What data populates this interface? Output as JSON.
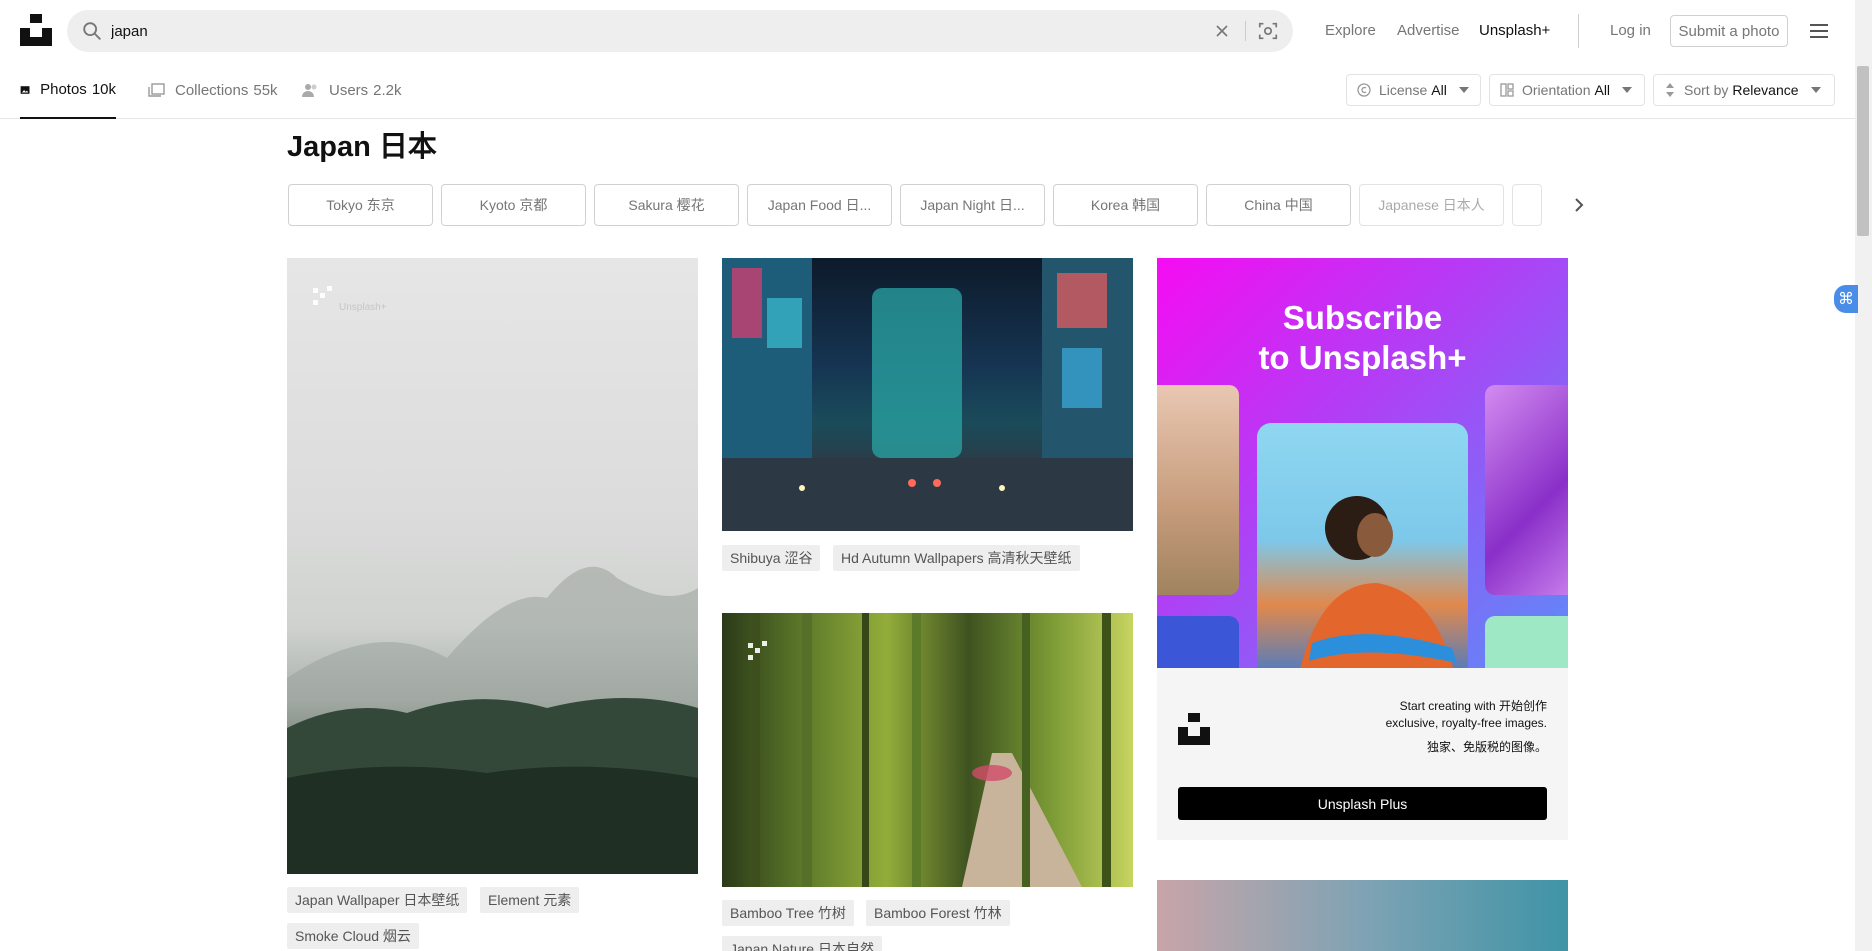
{
  "header": {
    "search_value": "japan",
    "nav": {
      "explore": "Explore",
      "advertise": "Advertise",
      "plus": "Unsplash+"
    },
    "login": "Log in",
    "submit": "Submit a photo"
  },
  "tabs": [
    {
      "label": "Photos",
      "count": "10k"
    },
    {
      "label": "Collections",
      "count": "55k"
    },
    {
      "label": "Users",
      "count": "2.2k"
    }
  ],
  "filters": {
    "license": {
      "label": "License",
      "value": "All"
    },
    "orientation": {
      "label": "Orientation",
      "value": "All"
    },
    "sort": {
      "label": "Sort by",
      "value": "Relevance"
    }
  },
  "page_title": "Japan 日本",
  "related": [
    "Tokyo 东京",
    "Kyoto 京都",
    "Sakura 樱花",
    "Japan Food 日...",
    "Japan Night 日...",
    "Korea 韩国",
    "China 中国",
    "Japanese 日本人"
  ],
  "photo_tags": {
    "mist": [
      "Japan Wallpaper 日本壁纸",
      "Element 元素",
      "Smoke Cloud 烟云"
    ],
    "shibuya": [
      "Shibuya 涩谷",
      "Hd Autumn Wallpapers 高清秋天壁纸"
    ],
    "bamboo": [
      "Bamboo Tree 竹树",
      "Bamboo Forest 竹林",
      "Japan Nature 日本自然"
    ]
  },
  "ad": {
    "title_line1": "Subscribe",
    "title_line2": "to Unsplash+",
    "text_line1": "Start creating with 开始创作",
    "text_line2": "exclusive, royalty-free images.",
    "text_line3": "独家、免版税的图像。",
    "button": "Unsplash Plus"
  },
  "watermark": "Unsplash+",
  "colors": {
    "active_tab": "#111111",
    "muted": "#767676",
    "ad_button": "#000000"
  },
  "icons": [
    "unsplash-logo-icon",
    "search-icon",
    "close-icon",
    "visual-search-icon",
    "hamburger-menu-icon",
    "photo-icon",
    "collection-icon",
    "users-icon",
    "license-icon",
    "orientation-icon",
    "sort-icon",
    "chevron-right-icon",
    "unsplash-plus-icon"
  ]
}
